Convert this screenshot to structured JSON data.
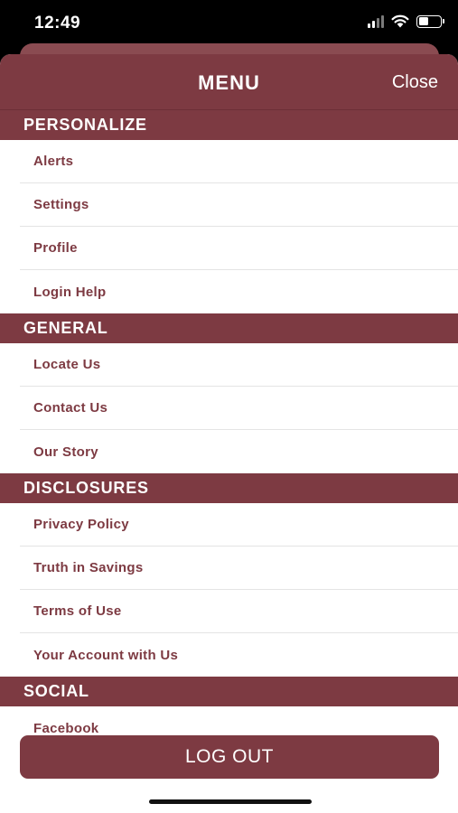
{
  "status": {
    "time": "12:49"
  },
  "header": {
    "title": "MENU",
    "close_label": "Close"
  },
  "sections": [
    {
      "title": "PERSONALIZE",
      "items": [
        "Alerts",
        "Settings",
        "Profile",
        "Login Help"
      ]
    },
    {
      "title": "GENERAL",
      "items": [
        "Locate Us",
        "Contact Us",
        "Our Story"
      ]
    },
    {
      "title": "DISCLOSURES",
      "items": [
        "Privacy Policy",
        "Truth in Savings",
        "Terms of Use",
        "Your Account with Us"
      ]
    },
    {
      "title": "SOCIAL",
      "items": [
        "Facebook"
      ]
    }
  ],
  "footer": {
    "logout_label": "LOG OUT"
  },
  "colors": {
    "brand": "#7d3a42",
    "background": "#ffffff",
    "divider": "#e4e4e4"
  }
}
